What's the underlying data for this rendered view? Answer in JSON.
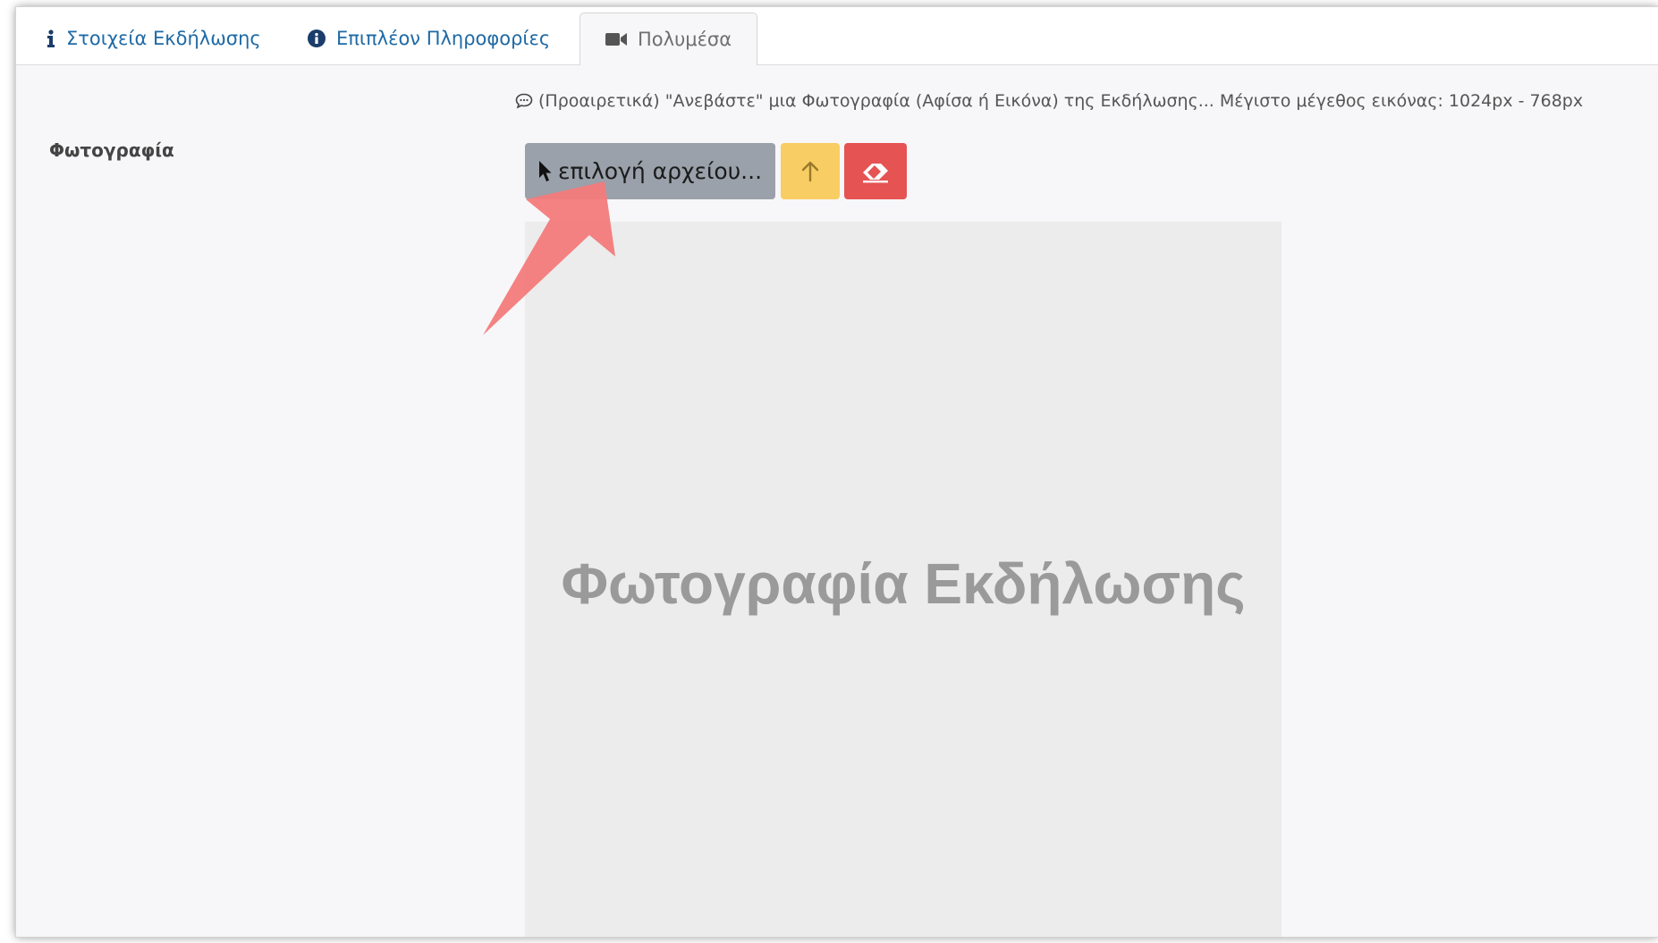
{
  "tabs": [
    {
      "label": "Στοιχεία Εκδήλωσης",
      "icon": "info-icon",
      "active": false
    },
    {
      "label": "Επιπλέον Πληροφορίες",
      "icon": "info-circle-icon",
      "active": false
    },
    {
      "label": "Πολυμέσα",
      "icon": "video-camera-icon",
      "active": true
    }
  ],
  "photo": {
    "hint": "(Προαιρετικά) \"Ανεβάστε\" μια Φωτογραφία (Αφίσα ή Εικόνα) της Εκδήλωσης... Μέγιστο μέγεθος εικόνας: 1024px - 768px",
    "label": "Φωτογραφία",
    "select_button": "επιλογή αρχείου...",
    "placeholder": "Φωτογραφία Εκδήλωσης"
  },
  "colors": {
    "link": "#1f6aa5",
    "select_button": "#9aa1aa",
    "upload_button": "#f8cd63",
    "clear_button": "#e55353",
    "annotation_arrow": "#f47b7b"
  }
}
